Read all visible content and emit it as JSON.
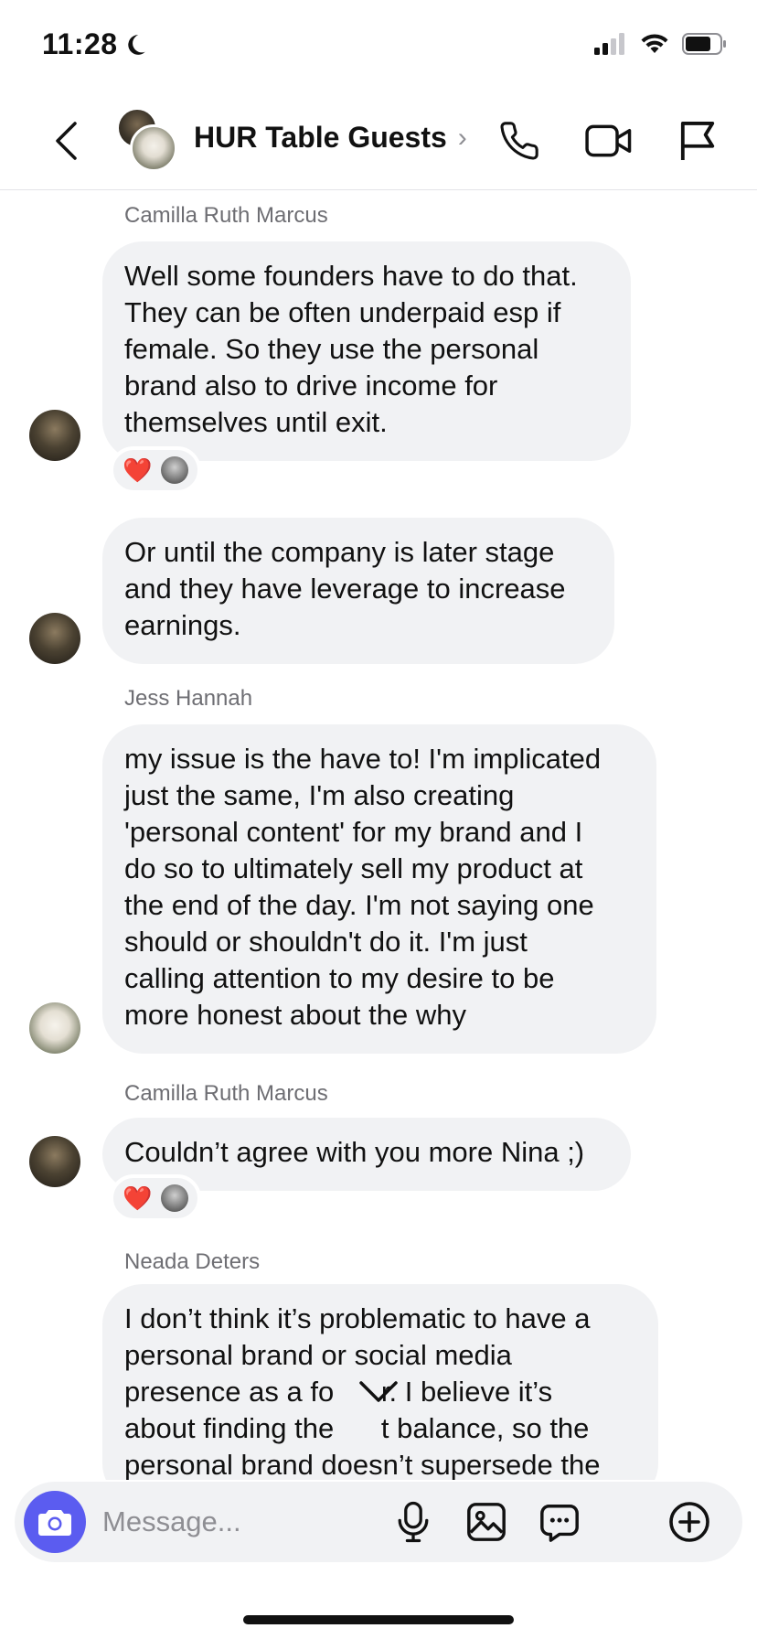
{
  "status_bar": {
    "time": "11:28"
  },
  "header": {
    "title": "HUR Table Guests"
  },
  "messages": [
    {
      "sender": "Camilla Ruth Marcus",
      "lines": [
        "Well some founders have to do that.",
        "They can be often underpaid esp if",
        "female. So they use the personal",
        "brand also to drive income for",
        "themselves until exit."
      ],
      "reaction": "❤️"
    },
    {
      "sender": "",
      "lines": [
        "Or until the company is later stage",
        "and they have leverage to increase",
        "earnings."
      ]
    },
    {
      "sender": "Jess Hannah",
      "lines": [
        "my issue is the have to! I'm implicated",
        "just the same, I'm also creating",
        "'personal content' for my brand and I",
        "do so to ultimately sell my product at",
        "the end of the day. I'm not saying one",
        "should or shouldn't do it. I'm just",
        "calling attention to my desire to be",
        "more honest about the why"
      ]
    },
    {
      "sender": "Camilla Ruth Marcus",
      "lines": [
        "Couldn’t agree with you more Nina ;)"
      ],
      "reaction": "❤️"
    },
    {
      "sender": "Neada Deters",
      "lines": [
        "I don’t think it’s problematic to have a",
        "personal brand or social media",
        "presence as a fo      r. I believe it’s",
        "about finding the      t balance, so the",
        "personal brand doesn’t supersede the"
      ]
    }
  ],
  "composer": {
    "placeholder": "Message..."
  },
  "colors": {
    "accent": "#5b5cf0",
    "bubble": "#f1f2f4",
    "heart": "#e8283c"
  }
}
